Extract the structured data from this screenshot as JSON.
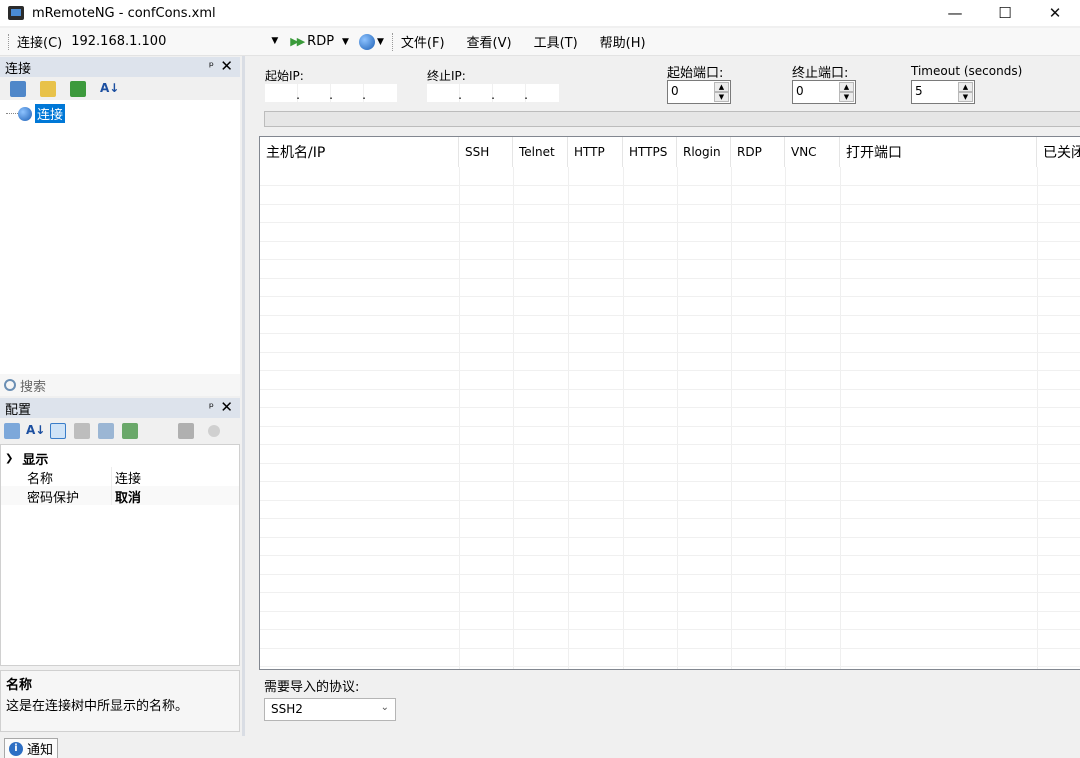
{
  "window": {
    "title": "mRemoteNG - confCons.xml",
    "minimize": "—",
    "maximize": "☐",
    "close": "✕"
  },
  "toolbar": {
    "connect_label": "连接(C)",
    "address_value": "192.168.1.100",
    "rdp_label": "RDP",
    "menus": [
      "文件(F)",
      "查看(V)",
      "工具(T)",
      "帮助(H)"
    ]
  },
  "connections_panel": {
    "title": "连接",
    "pin": "ᵖ",
    "close": "✕",
    "tree_root": "连接",
    "search_placeholder": "搜索"
  },
  "config_panel": {
    "title": "配置",
    "category": "显示",
    "rows": [
      {
        "key": "名称",
        "value": "连接"
      },
      {
        "key": "密码保护",
        "value": "取消"
      }
    ],
    "desc_title": "名称",
    "desc_text": "这是在连接树中所显示的名称。"
  },
  "port_scan": {
    "start_ip_label": "起始IP:",
    "end_ip_label": "终止IP:",
    "start_port_label": "起始端口:",
    "start_port_value": "0",
    "end_port_label": "终止端口:",
    "end_port_value": "0",
    "timeout_label": "Timeout (seconds)",
    "timeout_value": "5",
    "columns": [
      "主机名/IP",
      "SSH",
      "Telnet",
      "HTTP",
      "HTTPS",
      "Rlogin",
      "RDP",
      "VNC",
      "打开端口",
      "已关闭"
    ],
    "protocol_label": "需要导入的协议:",
    "protocol_value": "SSH2"
  },
  "statusbar": {
    "notice_tab": "通知"
  }
}
